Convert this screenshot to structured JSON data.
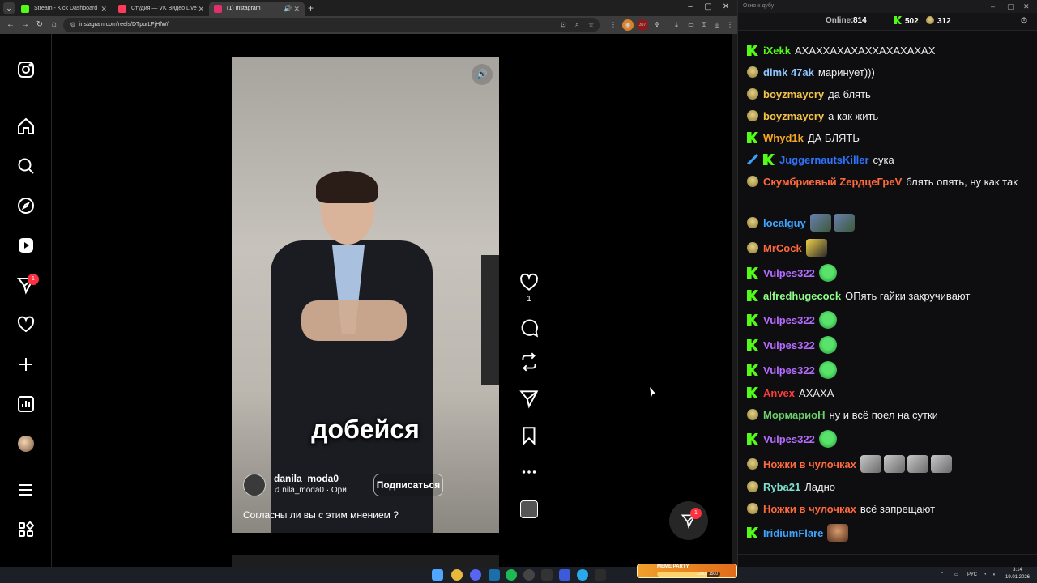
{
  "browser": {
    "tabs": [
      {
        "label": "Stream - Kick Dashboard",
        "favicon_color": "#53fc18",
        "active": false
      },
      {
        "label": "Студия — VK Видео Live",
        "favicon_color": "#ff3b5c",
        "active": false
      },
      {
        "label": "(1) Instagram",
        "favicon_color": "#e1306c",
        "active": true
      }
    ],
    "url": "instagram.com/reels/DTpurLFjHfW/",
    "extension_badge": "307"
  },
  "instagram": {
    "sidebar_icons": [
      "instagram-logo-icon",
      "home-icon",
      "search-icon",
      "explore-compass-icon",
      "reels-icon",
      "direct-messages-icon",
      "notifications-heart-icon",
      "create-plus-icon",
      "dashboard-chart-icon",
      "profile-avatar",
      "menu-icon",
      "more-apps-icon"
    ],
    "messages_badge": "1",
    "reel": {
      "caption_overlay": "добейся",
      "author": "danila_moda0",
      "audio": "nila_moda0 · Ори",
      "follow_label": "Подписаться",
      "description": "Согласны ли вы с этим мнением ?"
    },
    "actions": {
      "like_count": "1"
    },
    "dm_fab_badge": "1"
  },
  "chat": {
    "window_title": "Окно к дубу",
    "online_label": "Online:",
    "online_count": "814",
    "kick_count": "502",
    "coin_count": "312",
    "colors": {
      "kick_green": "#53fc18"
    },
    "messages": [
      {
        "badge": "kick",
        "user": "iXekk",
        "color": "#53fc18",
        "text": "АХАХХАХАХАХХАХАХАХАХ",
        "emotes": []
      },
      {
        "badge": "doge",
        "user": "dimk 47ak",
        "color": "#8ec5ff",
        "text": "маринует)))",
        "emotes": []
      },
      {
        "badge": "doge",
        "user": "boyzmaycry",
        "color": "#f3c24b",
        "text": "да блять",
        "emotes": []
      },
      {
        "badge": "doge",
        "user": "boyzmaycry",
        "color": "#f3c24b",
        "text": "а как жить",
        "emotes": []
      },
      {
        "badge": "kick",
        "user": "Whyd1k",
        "color": "#f5a623",
        "text": "ДА БЛЯТЬ",
        "emotes": []
      },
      {
        "badge": "sword+kick",
        "user": "JuggernautsKiller",
        "color": "#2f74ff",
        "text": "сука",
        "emotes": []
      },
      {
        "badge": "doge",
        "user": "Скумбриевый ZердцеГреV",
        "color": "#ff6a3d",
        "text": "блять опять, ну как так",
        "emotes": []
      },
      {
        "badge": "doge",
        "user": "localguy",
        "color": "#3ea6ff",
        "text": "",
        "emotes": [
          "frogpic",
          "frogpic"
        ]
      },
      {
        "badge": "doge",
        "user": "MrCock",
        "color": "#ff6a3d",
        "text": "",
        "emotes": [
          "mix"
        ]
      },
      {
        "badge": "kick",
        "user": "Vulpes322",
        "color": "#b46cff",
        "text": "",
        "emotes": [
          "green"
        ]
      },
      {
        "badge": "kick",
        "user": "alfredhugecock",
        "color": "#8fff8a",
        "text": "ОПять гайки закручивают",
        "emotes": []
      },
      {
        "badge": "kick",
        "user": "Vulpes322",
        "color": "#b46cff",
        "text": "",
        "emotes": [
          "green"
        ]
      },
      {
        "badge": "kick",
        "user": "Vulpes322",
        "color": "#b46cff",
        "text": "",
        "emotes": [
          "green"
        ]
      },
      {
        "badge": "kick",
        "user": "Vulpes322",
        "color": "#b46cff",
        "text": "",
        "emotes": [
          "green"
        ]
      },
      {
        "badge": "kick",
        "user": "Anvex",
        "color": "#ff3b3b",
        "text": "АХАХА",
        "emotes": []
      },
      {
        "badge": "doge",
        "user": "МормариоН",
        "color": "#6ccf6c",
        "text": "ну и всё поел на сутки",
        "emotes": []
      },
      {
        "badge": "kick",
        "user": "Vulpes322",
        "color": "#b46cff",
        "text": "",
        "emotes": [
          "green"
        ]
      },
      {
        "badge": "doge",
        "user": "Ножки в чулочках",
        "color": "#ff6a3d",
        "text": "",
        "emotes": [
          "gray",
          "gray",
          "gray",
          "gray"
        ]
      },
      {
        "badge": "doge",
        "user": "Ryba21",
        "color": "#7fe0d0",
        "text": "Ладно",
        "emotes": []
      },
      {
        "badge": "doge",
        "user": "Ножки в чулочках",
        "color": "#ff6a3d",
        "text": "всё запрещают",
        "emotes": []
      },
      {
        "badge": "kick",
        "user": "IridiumFlare",
        "color": "#3ea6ff",
        "text": "",
        "emotes": [
          "face"
        ]
      }
    ]
  },
  "taskbar": {
    "meme_party_title": "MEME PARTY",
    "meme_party_progress": "1200 / 1500",
    "meme_party_fraction": 0.8,
    "lang": "РУС",
    "time": "3:14",
    "date": "19.01.2026"
  }
}
